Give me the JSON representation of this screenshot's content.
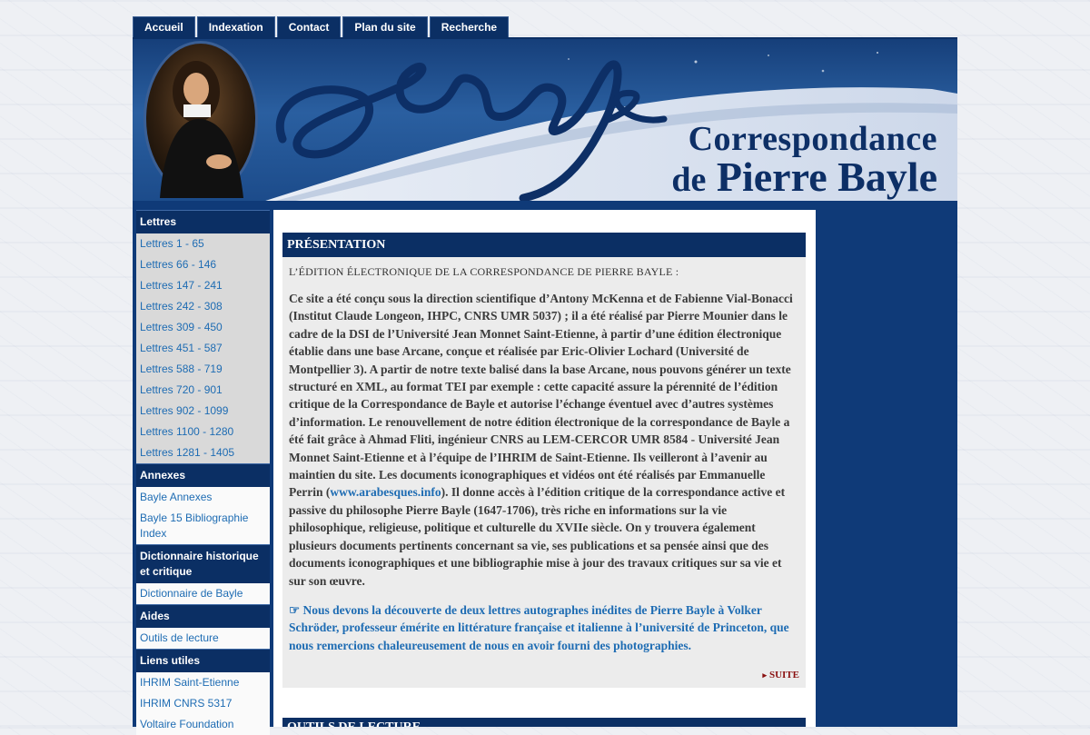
{
  "nav": {
    "tabs": [
      "Accueil",
      "Indexation",
      "Contact",
      "Plan du site",
      "Recherche"
    ]
  },
  "banner": {
    "title_line1": "Correspondance",
    "title_de": "de",
    "title_name": "Pierre Bayle"
  },
  "sidebar": {
    "sections": [
      {
        "heading": "Lettres",
        "items": [
          "Lettres 1 - 65",
          "Lettres 66 - 146",
          "Lettres 147 - 241",
          "Lettres 242 - 308",
          "Lettres 309 - 450",
          "Lettres 451 - 587",
          "Lettres 588 - 719",
          "Lettres 720 - 901",
          "Lettres 902 - 1099",
          "Lettres 1100 - 1280",
          "Lettres 1281 - 1405"
        ]
      },
      {
        "heading": "Annexes",
        "items": [
          "Bayle Annexes",
          "Bayle 15 Bibliographie Index"
        ]
      },
      {
        "heading": "Dictionnaire historique et critique",
        "items": [
          "Dictionnaire de Bayle"
        ]
      },
      {
        "heading": "Aides",
        "items": [
          "Outils de lecture"
        ]
      },
      {
        "heading": "Liens utiles",
        "items": [
          "IHRIM Saint-Etienne",
          "IHRIM CNRS 5317",
          "Voltaire Foundation"
        ]
      }
    ]
  },
  "main": {
    "section_title": "PRÉSENTATION",
    "subtitle": "L’ÉDITION ÉLECTRONIQUE DE LA CORRESPONDANCE DE PIERRE BAYLE :",
    "paragraph_before_link": "Ce site a été conçu sous la direction scientifique d’Antony McKenna et de Fabienne Vial-Bonacci (Institut Claude Longeon, IHPC, CNRS UMR 5037) ; il a été réalisé par Pierre Mounier dans le cadre de la DSI de l’Université Jean Monnet Saint-Etienne, à partir d’une édition électronique établie dans une base Arcane, conçue et réalisée par Eric-Olivier Lochard (Université de Montpellier 3). A partir de notre texte balisé dans la base Arcane, nous pouvons générer un texte structuré en XML, au format TEI par exemple : cette capacité assure la pérennité de l’édition critique de la Correspondance de Bayle et autorise l’échange éventuel avec d’autres systèmes d’information. Le renouvellement de notre édition électronique de la correspondance de Bayle a été fait grâce à Ahmad Fliti, ingénieur CNRS au LEM-CERCOR UMR 8584 - Université Jean Monnet Saint-Etienne et à l’équipe de l’IHRIM de Saint-Etienne. Ils veilleront à l’avenir au maintien du site. Les documents iconographiques et vidéos ont été réalisés par Emmanuelle Perrin (",
    "link_text": "www.arabesques.info",
    "paragraph_after_link": "). Il donne accès à l’édition critique de la correspondance active et passive du philosophe Pierre Bayle (1647-1706), très riche en informations sur la vie philosophique, religieuse, politique et culturelle du XVIIe siècle. On y trouvera également plusieurs documents pertinents concernant sa vie, ses publications et sa pensée ainsi que des documents iconographiques et une bibliographie mise à jour des travaux critiques sur sa vie et sur son œuvre.",
    "note_icon": "☞",
    "note_text": "Nous devons la découverte de deux lettres autographes inédites de Pierre Bayle à Volker Schröder, professeur émérite en littérature française et italienne à l’université de Princeton, que nous remercions chaleureusement de nous en avoir fourni des photographies.",
    "suite_label": "SUITE",
    "second_section_title": "OUTILS DE LECTURE"
  },
  "colors": {
    "navy": "#0b2f64",
    "link": "#1e6cb3",
    "suite": "#8a1010"
  }
}
